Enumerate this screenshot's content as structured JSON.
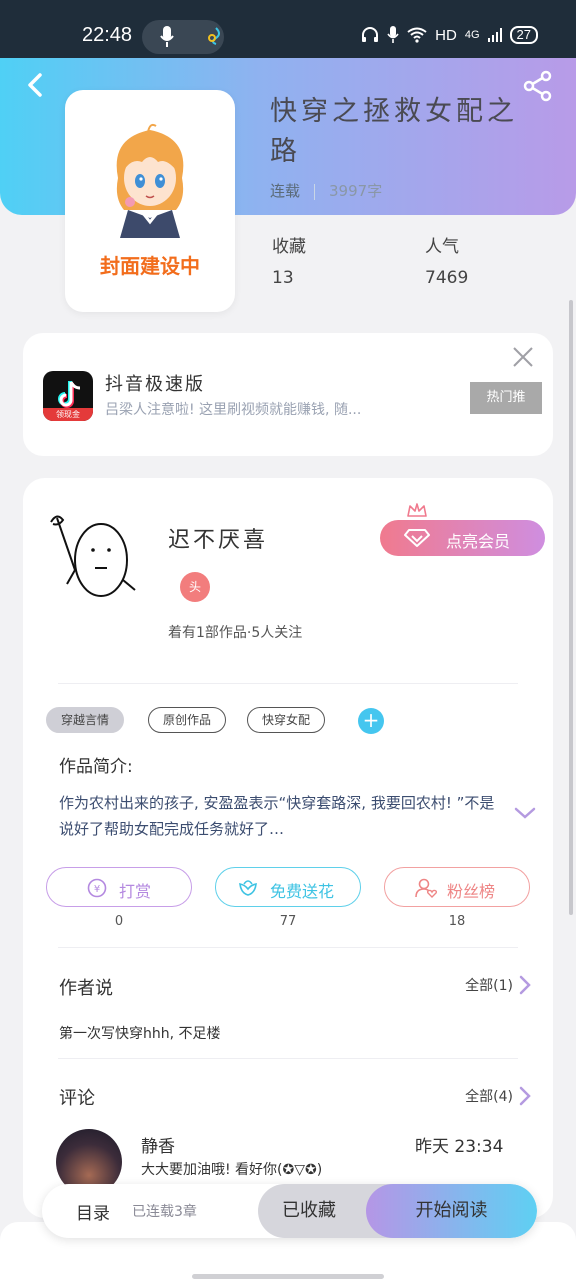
{
  "status_bar": {
    "time": "22:48",
    "network": "HD",
    "signal": "4G",
    "battery": "27"
  },
  "book": {
    "title": "快穿之拯救女配之路",
    "status": "连载",
    "word_count": "3997字",
    "cover_text": "封面建设中",
    "favorites_label": "收藏",
    "favorites_value": "13",
    "popularity_label": "人气",
    "popularity_value": "7469"
  },
  "ad": {
    "app_name": "抖音极速版",
    "description": "吕梁人注意啦! 这里刷视频就能赚钱, 随...",
    "tag": "热门推",
    "icon_badge": "领现金"
  },
  "author": {
    "name": "迟不厌喜",
    "level_badge": "头",
    "stats": "着有1部作品·5人关注",
    "vip_button": "点亮会员"
  },
  "tags": [
    "穿越言情",
    "原创作品",
    "快穿女配"
  ],
  "intro": {
    "title": "作品简介:",
    "text": "作为农村出来的孩子, 安盈盈表示“快穿套路深, 我要回农村! ”不是说好了帮助女配完成任务就好了…"
  },
  "actions": [
    {
      "label": "打赏",
      "count": "0"
    },
    {
      "label": "免费送花",
      "count": "77"
    },
    {
      "label": "粉丝榜",
      "count": "18"
    }
  ],
  "author_says": {
    "title": "作者说",
    "more": "全部(1)",
    "text": "第一次写快穿hhh, 不足楼"
  },
  "comments": {
    "title": "评论",
    "more": "全部(4)",
    "first": {
      "user": "静香",
      "time": "昨天 23:34",
      "text": "大大要加油哦! 看好你(✪▽✪)"
    }
  },
  "bottom_bar": {
    "toc": "目录",
    "chapters": "已连载3章",
    "collected": "已收藏",
    "read": "开始阅读"
  },
  "colors": {
    "header_start": "#4fd0f5",
    "header_end": "#b89be8",
    "accent_blue": "#45c6ef",
    "vip_pink": "#f07a8e",
    "cover_orange": "#f26d1c"
  }
}
